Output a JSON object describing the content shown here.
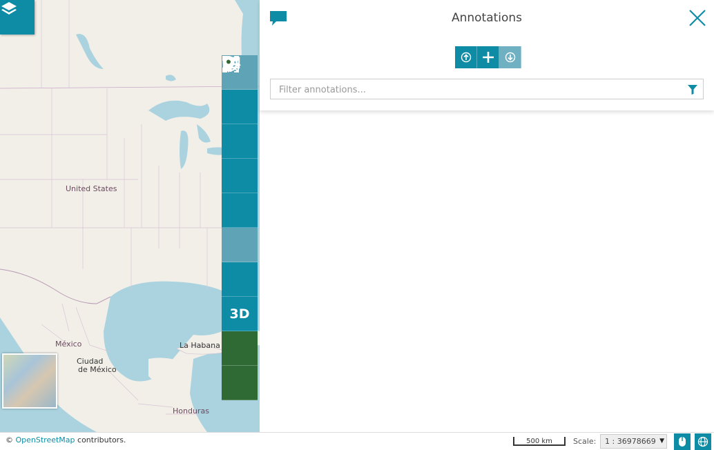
{
  "map": {
    "labels": {
      "united_states": "United States",
      "mexico": "México",
      "ciudad_mexico_line1": "Ciudad",
      "ciudad_mexico_line2": "de México",
      "la_habana": "La Habana",
      "honduras": "Honduras"
    },
    "attribution_prefix": "©",
    "attribution_link": "OpenStreetMap",
    "attribution_suffix": "contributors."
  },
  "toolbar": {
    "items": [
      {
        "name": "locate",
        "icon": "crosshair-icon"
      },
      {
        "name": "zoom-in",
        "icon": "plus-icon"
      },
      {
        "name": "zoom-out",
        "icon": "minus-icon"
      },
      {
        "name": "zoom-extent",
        "icon": "expand-extent-icon"
      },
      {
        "name": "previous-view",
        "icon": "undo-view-icon"
      },
      {
        "name": "next-view",
        "icon": "redo-view-icon"
      },
      {
        "name": "fullscreen",
        "icon": "fullscreen-icon"
      },
      {
        "name": "3d",
        "label": "3D"
      },
      {
        "name": "annotations",
        "icon": "map-marker-icon"
      },
      {
        "name": "more",
        "icon": "ellipsis-icon"
      }
    ]
  },
  "panel": {
    "title": "Annotations",
    "filter_placeholder": "Filter annotations...",
    "filter_value": ""
  },
  "footer": {
    "scale_bar_label": "500 km",
    "scale_label": "Scale:",
    "scale_value": "1 : 36978669"
  },
  "colors": {
    "accent": "#0e8ca6",
    "green": "#2f6a35",
    "water": "#aad3df",
    "land": "#f2efe9"
  }
}
